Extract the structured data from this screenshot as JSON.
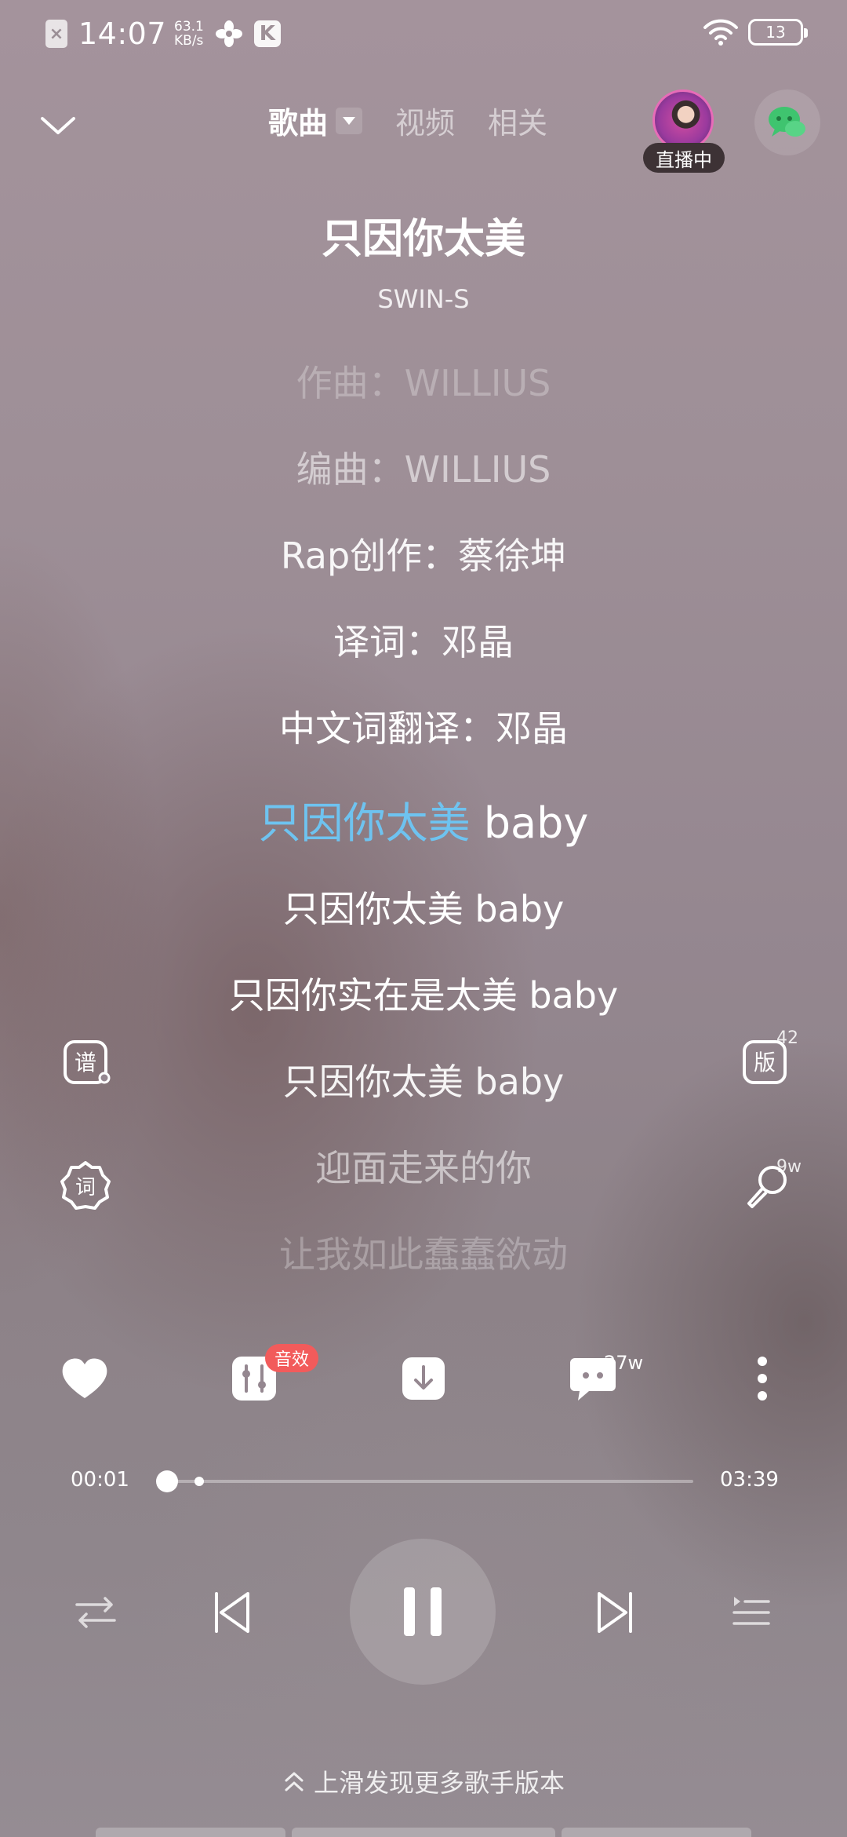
{
  "status_bar": {
    "time": "14:07",
    "net_speed_value": "63.1",
    "net_speed_unit": "KB/s",
    "battery": "13",
    "icons": [
      "sim-off-icon",
      "fan-icon",
      "k-app-icon",
      "wifi-icon",
      "battery-icon"
    ]
  },
  "nav": {
    "tabs": [
      {
        "label": "歌曲",
        "active": true
      },
      {
        "label": "视频",
        "active": false
      },
      {
        "label": "相关",
        "active": false
      }
    ],
    "live_badge": "直播中"
  },
  "song": {
    "title": "只因你太美",
    "artist": "SWIN-S"
  },
  "lyrics": [
    {
      "text": "作曲：WILLIUS",
      "state": "faded"
    },
    {
      "text": "编曲：WILLIUS",
      "state": "dim"
    },
    {
      "text": "Rap创作：蔡徐坤",
      "state": "normal"
    },
    {
      "text": "译词：邓晶",
      "state": "normal"
    },
    {
      "text": "中文词翻译：邓晶",
      "state": "normal"
    },
    {
      "highlight": "只因你太美",
      "rest": " baby",
      "state": "current"
    },
    {
      "text": "只因你太美 baby",
      "state": "normal"
    },
    {
      "text": "只因你实在是太美 baby",
      "state": "normal"
    },
    {
      "text": "只因你太美 baby",
      "state": "normal"
    },
    {
      "text": "迎面走来的你",
      "state": "dim"
    },
    {
      "text": "让我如此蠢蠢欲动",
      "state": "faded"
    }
  ],
  "side": {
    "score_label": "谱",
    "lyrics_label": "词",
    "version_label": "版",
    "version_count": "42",
    "sing_count": "9w"
  },
  "actions": {
    "fx_badge": "音效",
    "comment_count": "27w"
  },
  "progress": {
    "current": "00:01",
    "total": "03:39",
    "fraction": 0.005
  },
  "swipe_hint": "上滑发现更多歌手版本",
  "colors": {
    "highlight": "#6ec3f0",
    "badge_red": "#f25b5b"
  }
}
